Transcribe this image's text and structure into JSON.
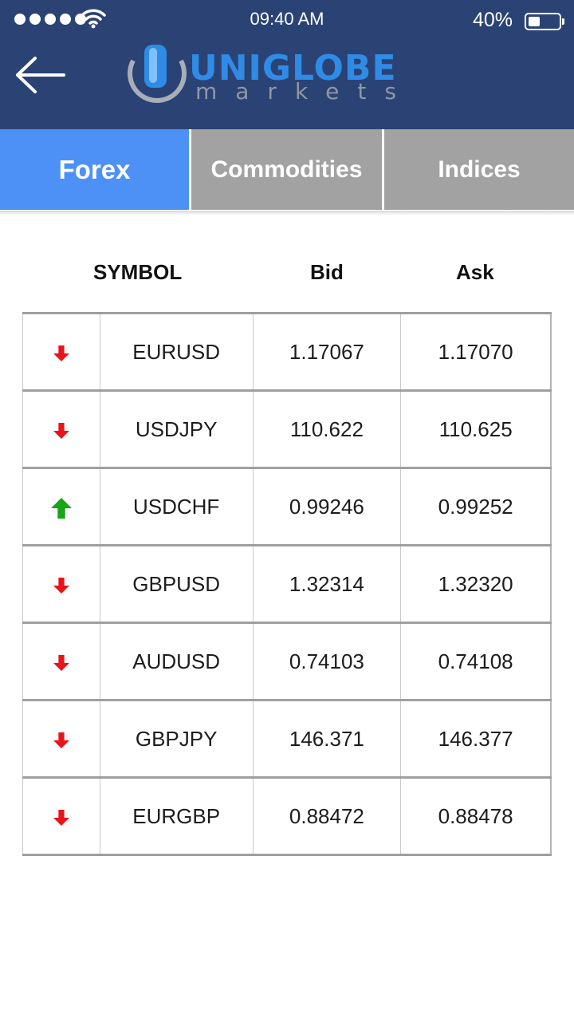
{
  "status_bar": {
    "time": "09:40 AM",
    "battery": "40%",
    "battery_level": 0.4
  },
  "header": {
    "back_icon": "arrow-left-icon",
    "logo": {
      "word": "UNIGLOBE",
      "sub": "markets"
    }
  },
  "tabs": [
    {
      "label": "Forex",
      "active": true
    },
    {
      "label": "Commodities",
      "active": false
    },
    {
      "label": "Indices",
      "active": false
    }
  ],
  "table": {
    "columns": [
      "SYMBOL",
      "Bid",
      "Ask"
    ],
    "rows": [
      {
        "direction": "down",
        "symbol": "EURUSD",
        "bid": "1.17067",
        "ask": "1.17070"
      },
      {
        "direction": "down",
        "symbol": "USDJPY",
        "bid": "110.622",
        "ask": "110.625"
      },
      {
        "direction": "up",
        "symbol": "USDCHF",
        "bid": "0.99246",
        "ask": "0.99252"
      },
      {
        "direction": "down",
        "symbol": "GBPUSD",
        "bid": "1.32314",
        "ask": "1.32320"
      },
      {
        "direction": "down",
        "symbol": "AUDUSD",
        "bid": "0.74103",
        "ask": "0.74108"
      },
      {
        "direction": "down",
        "symbol": "GBPJPY",
        "bid": "146.371",
        "ask": "146.377"
      },
      {
        "direction": "down",
        "symbol": "EURGBP",
        "bid": "0.88472",
        "ask": "0.88478"
      }
    ]
  },
  "colors": {
    "header_bg": "#2a4374",
    "tab_active": "#4d91f7",
    "tab_inactive": "#a2a2a2",
    "down": "#e8141a",
    "up": "#18a518"
  }
}
